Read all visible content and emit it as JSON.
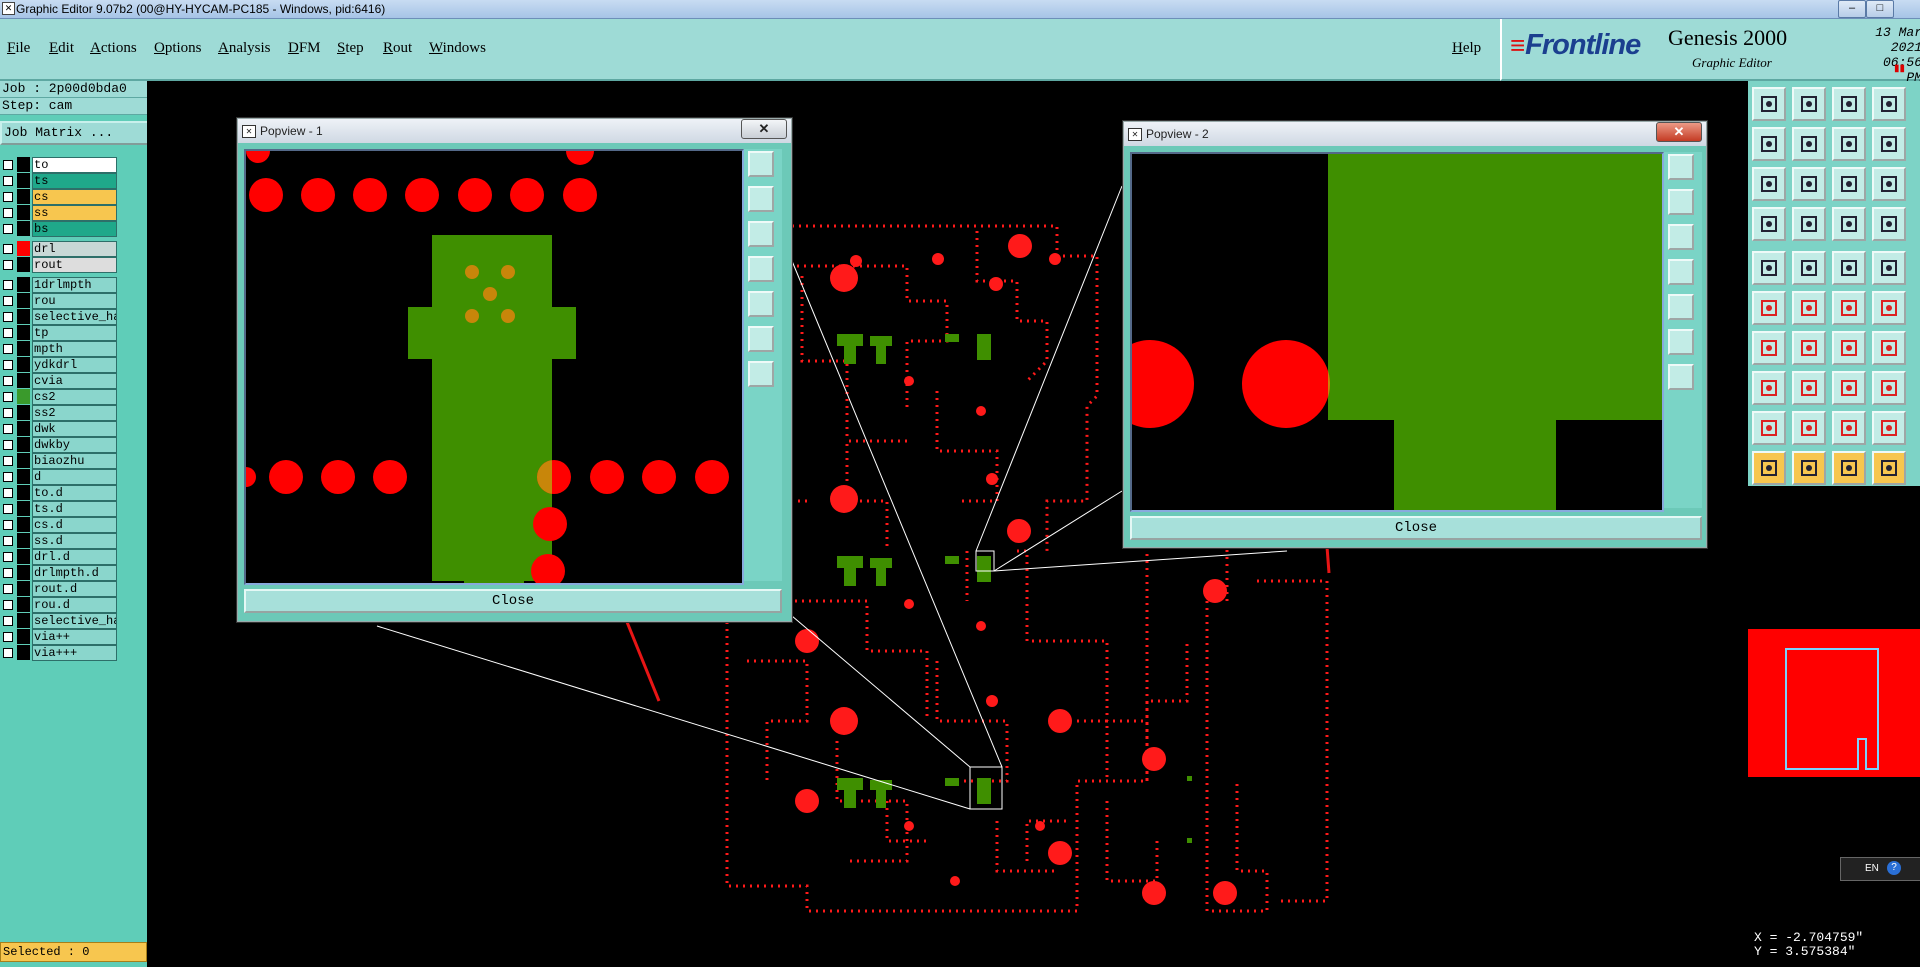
{
  "window": {
    "title": "Graphic Editor 9.07b2 (00@HY-HYCAM-PC185 - Windows, pid:6416)"
  },
  "menu": {
    "items": [
      "File",
      "Edit",
      "Actions",
      "Options",
      "Analysis",
      "DFM",
      "Step",
      "Rout",
      "Windows"
    ],
    "help": "Help"
  },
  "brand": {
    "logo": "Frontline",
    "product": "Genesis 2000",
    "subtitle": "Graphic Editor",
    "date": "13 Mar 2021",
    "time": "06:56 PM"
  },
  "job": {
    "job_label": "Job : 2p00d0bda0",
    "step_label": "Step: cam",
    "matrix_button": "Job Matrix ..."
  },
  "layers": [
    {
      "name": "to",
      "color": "#000000",
      "bg": "#ffffff"
    },
    {
      "name": "ts",
      "color": "#000000",
      "bg": "#1fa88a"
    },
    {
      "name": "cs",
      "color": "#000000",
      "bg": "#f7c64f"
    },
    {
      "name": "ss",
      "color": "#000000",
      "bg": "#f7c64f"
    },
    {
      "name": "bs",
      "color": "#000000",
      "bg": "#1fa88a"
    },
    {
      "name": "drl",
      "color": "#ff0000",
      "bg": "#c8d8d6"
    },
    {
      "name": "rout",
      "color": "#000000",
      "bg": "#dddddd"
    },
    {
      "name": "1drlmpth",
      "color": "#000000",
      "bg": "#8ad6cc"
    },
    {
      "name": "rou",
      "color": "#000000",
      "bg": "#8ad6cc"
    },
    {
      "name": "selective_ha",
      "color": "#000000",
      "bg": "#8ad6cc"
    },
    {
      "name": "tp",
      "color": "#000000",
      "bg": "#8ad6cc"
    },
    {
      "name": "mpth",
      "color": "#000000",
      "bg": "#8ad6cc"
    },
    {
      "name": "ydkdrl",
      "color": "#000000",
      "bg": "#8ad6cc"
    },
    {
      "name": "cvia",
      "color": "#000000",
      "bg": "#8ad6cc"
    },
    {
      "name": "cs2",
      "color": "#3a9a2c",
      "bg": "#8ad6cc"
    },
    {
      "name": "ss2",
      "color": "#000000",
      "bg": "#8ad6cc"
    },
    {
      "name": "dwk",
      "color": "#000000",
      "bg": "#8ad6cc"
    },
    {
      "name": "dwkby",
      "color": "#000000",
      "bg": "#8ad6cc"
    },
    {
      "name": "biaozhu",
      "color": "#000000",
      "bg": "#8ad6cc"
    },
    {
      "name": "d",
      "color": "#000000",
      "bg": "#8ad6cc"
    },
    {
      "name": "to.d",
      "color": "#000000",
      "bg": "#8ad6cc"
    },
    {
      "name": "ts.d",
      "color": "#000000",
      "bg": "#8ad6cc"
    },
    {
      "name": "cs.d",
      "color": "#000000",
      "bg": "#8ad6cc"
    },
    {
      "name": "ss.d",
      "color": "#000000",
      "bg": "#8ad6cc"
    },
    {
      "name": "drl.d",
      "color": "#000000",
      "bg": "#8ad6cc"
    },
    {
      "name": "drlmpth.d",
      "color": "#000000",
      "bg": "#8ad6cc"
    },
    {
      "name": "rout.d",
      "color": "#000000",
      "bg": "#8ad6cc"
    },
    {
      "name": "rou.d",
      "color": "#000000",
      "bg": "#8ad6cc"
    },
    {
      "name": "selective_ha",
      "color": "#000000",
      "bg": "#8ad6cc"
    },
    {
      "name": "via++",
      "color": "#000000",
      "bg": "#8ad6cc"
    },
    {
      "name": "via+++",
      "color": "#000000",
      "bg": "#8ad6cc"
    }
  ],
  "status": {
    "selected": "Selected : 0"
  },
  "popview1": {
    "title": "Popview - 1",
    "close_label": "Close"
  },
  "popview2": {
    "title": "Popview - 2",
    "close_label": "Close"
  },
  "coords": {
    "x": "X = -2.704759\"",
    "y": "Y = 3.575384\""
  },
  "tray": {
    "lang": "EN"
  },
  "colors": {
    "board_bg": "#000000",
    "drill": "#ff0000",
    "copper": "#3f8f00",
    "panel": "#5fcdb8",
    "menu": "#9edbd6"
  }
}
